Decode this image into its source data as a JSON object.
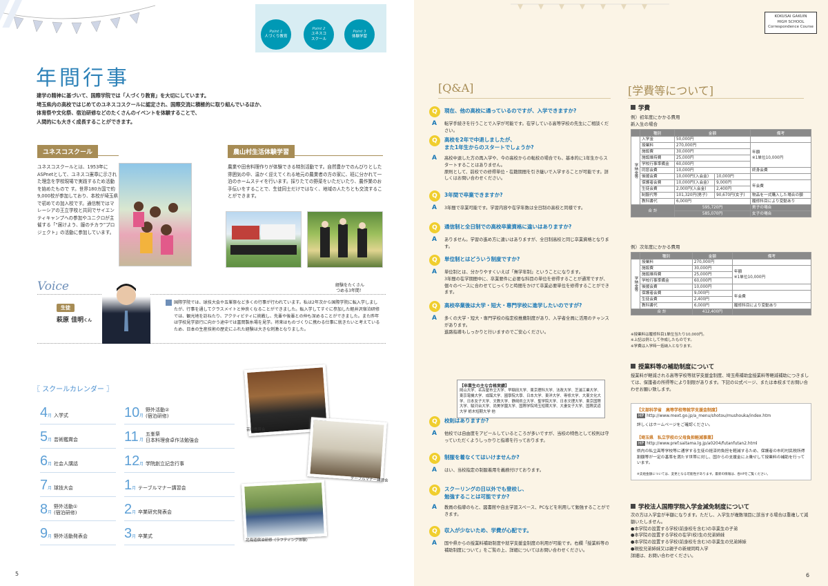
{
  "left": {
    "points": [
      {
        "tag": "Point 1",
        "label": "人づくり教育"
      },
      {
        "tag": "Point 2",
        "label": "ユネスコ\nスクール"
      },
      {
        "tag": "Point 3",
        "label": "体験学習"
      }
    ],
    "title": "年間行事",
    "intro": "建学の精神に基づいて、国際学院では「人づくり教育」を大切にしています。\n埼玉県内の高校ではじめてのユネスコスクールに認定され、国際交流に積極的に取り組んでいるほか、\n体育祭や文化祭、宿泊研修などのたくさんのイベントを体験することで、\n人間的にも大きく成長することができます。",
    "unesco": {
      "heading": "ユネスコスクール",
      "text": "ユネスコスクールとは、1953年にASPnetとして、ユネスコ憲章に示された理念を学校現場で実践するため活動を始めたもので す。世界180カ国で約9,000校が参加しており、本校が埼玉県で初めての加入校です。通信制ではマレーシアの王立学校と共同でサイエンティキャンプへの参加やユニクロが主催する「“届けよう、服のチカラ”プロジェクト」の活動に参加しています。"
    },
    "farm": {
      "heading": "農山村生活体験学習",
      "text": "農業や田舎料理作りが体験できる特別活動です。自然豊かでのんびりとした雰囲気の中、温かく迎えてくれる地元の農業者の方の家に、班に分かれて一泊のホームステイを行います。採りたての野菜をいただいたり、農作業のお手伝いをすることで、生徒同士だけではなく、地域の人たちとも交流することができます。"
    },
    "voice": {
      "label": "Voice",
      "note": "経験をたくさん\nつめる3年間！",
      "role": "生徒",
      "name": "萩原 佳明",
      "suffix": "くん",
      "text": "国際学院では、球技大会や五峯祭など多くの行事が行われています。私は2年次から国際学院に転入学しましたが、行事を通してクラスメイトと仲良くなることができました。転入学してすぐに参加した軽井沢宿泊研修では、観光地を訪ねたり、アクティビティに挑戦し、先輩や後輩との仲も深めることができました。また昨年は学校見学旅行に向かう途中では冨岡製糸場を見学。将来はものづくりに携わる仕事に就きたいと考えているため、日本の生産技術の歴史にふれた経験は大きな刺激となりました。"
    },
    "calendar": {
      "heading": "スクールカレンダー",
      "unit": "月",
      "items": [
        {
          "month": "4",
          "text": "入学式"
        },
        {
          "month": "5",
          "text": "芸術鑑賞会"
        },
        {
          "month": "6",
          "text": "社会人講話"
        },
        {
          "month": "7",
          "text": "球技大会"
        },
        {
          "month": "8",
          "text": "野外活動①\n(宿泊研修)"
        },
        {
          "month": "9",
          "text": "野外活動発表会"
        },
        {
          "month": "10",
          "text": "野外活動②\n(宿泊研修)"
        },
        {
          "month": "11",
          "text": "五峯祭\n日本料理食卓作法勉強会"
        },
        {
          "month": "12",
          "text": "学院創立記念行事"
        },
        {
          "month": "1",
          "text": "テーブルマナー講習会"
        },
        {
          "month": "2",
          "text": "卒業研究発表会"
        },
        {
          "month": "3",
          "text": "卒業式"
        }
      ]
    },
    "captions": {
      "art": "芸術鑑賞会",
      "manner": "テーブルマナー講習会",
      "rafting": "北海道宿泊研修（ラフティング体験）"
    },
    "page": "5"
  },
  "right": {
    "badge": "KOKUSAI GAKUIN\nHIGH SCHOOL\nCorrespondence Course",
    "qa_title": "[Q&A]",
    "qa": [
      {
        "q": "現在、他の高校に通っているのですが、入学できますか?",
        "a": "転学手続きを行うことで入学が可能です。在学している高等学校の先生にご相談ください。"
      },
      {
        "q": "高校を2年で中退しましたが、\nまた1年生からのスタートでしょうか?",
        "a": "高校中退した方の再入学や、今の高校からの転校の場合でも、基本的に1年生からスタートすることはありません。\n原則として、前校での修得単位・在籍期間を引き継いで入学することが可能です。詳しくはお問い合わせください。"
      },
      {
        "q": "3年間で卒業できますか?",
        "a": "3年間で卒業可能です。学習内容や在学年数は全日制の高校と同様です。"
      },
      {
        "q": "通信制と全日制での高校卒業資格に違いはありますか?",
        "a": "ありません。学習の進め方に違いはありますが、全日制高校と同じ卒業資格となります。"
      },
      {
        "q": "単位制とはどういう制度ですか?",
        "a": "単位制とは、分かりやすくいえば「無学年制」ということになります。\n3年間の在学期間中に、卒業要件に必要な科目の単位を修得することが通常ですが、個々のペースに合わせてじっくりと時間をかけて卒業必要単位を修得することができます。"
      },
      {
        "q": "高校卒業後は大学・短大・専門学校に進学したいのですが?",
        "a": "多くの大学・短大・専門学校の指定校推薦制度があり、入学者全員に活用のチャンスがあります。\n進路指導もしっかりと行いますのでご安心ください。"
      },
      {
        "q": "校則はありますか?",
        "a": "他校では自由度をアピールしているところが多いですが、当校の特色として校則は守っていただくようしっかりと指導を行っております。"
      },
      {
        "q": "制服を着なくてはいけませんか?",
        "a": "はい、当校指定の制服着用を義務付けております。"
      },
      {
        "q": "スクーリングの日以外でも登校し、\n勉強することは可能ですか?",
        "a": "教員の指導のもと、図書館や自主学習スペース、PCなどを利用して勉強することができます。"
      },
      {
        "q": "収入が少ないため、学費が心配です。",
        "a": "国や県からの授業料補助制度や就学支援金制度の利用が可能です。右欄「授業料等の補助制度について」をご覧の上、詳細についてはお問い合わせください。"
      }
    ],
    "results": {
      "title": "【卒業生の主な合格実績】",
      "text": "岡山大学、名古屋市立大学、早稲田大学、東京理科大学、法政大学、芝浦工業大学、東京電機大学、成蹊大学、國學院大學、日本大学、東洋大学、専修大学、大東文化大学、日本女子大学、文教大学、静岡県立大学、聖学院大学、日本文理大学、東京国際大学、駿河台大学、尚美学園大学、国際学院埼玉短期大学、大妻女子大学、国際武道大学 栃木短期大学 他"
    },
    "fee_title": "[学費等について]",
    "fee": {
      "heading": "学費",
      "case1": "例）初年度にかかる費用\n新入生の場合",
      "col": [
        "種別",
        "金額",
        "備考"
      ],
      "side": "学納金等",
      "rows1": [
        [
          "入学金",
          "50,000円",
          "",
          ""
        ],
        [
          "授業料",
          "270,000円",
          "",
          ""
        ],
        [
          "施設費",
          "30,000円",
          "",
          ""
        ],
        [
          "施設維持費",
          "25,000円",
          "",
          ""
        ],
        [
          "学校行事準備金",
          "60,000円",
          "",
          ""
        ],
        [
          "同窓会費",
          "10,000円",
          "",
          "終身会費"
        ],
        [
          "後援会費",
          "10,000円(入会金)",
          "10,000円",
          ""
        ],
        [
          "保護者会費",
          "10,000円(入会金)",
          "9,000円",
          "年会費"
        ],
        [
          "生徒会費",
          "2,000円(入会金)",
          "2,400円",
          ""
        ],
        [
          "制服代等",
          "101,320円(男子)",
          "90,670円(女子)",
          "物品を一式購入した場合の額"
        ],
        [
          "教科書代",
          "6,000円",
          "",
          "履修科目により変動あり"
        ]
      ],
      "note1a": "年額\n※1単位10,000円",
      "total1": "合 計",
      "totals1": [
        "595,720円",
        "585,070円"
      ],
      "totalsNote1": [
        "男子の場合",
        "女子の場合"
      ],
      "case2": "例）次年度にかかる費用",
      "rows2": [
        [
          "授業料",
          "270,000円",
          ""
        ],
        [
          "施設費",
          "30,000円",
          ""
        ],
        [
          "施設維持費",
          "25,000円",
          ""
        ],
        [
          "学校行事準備金",
          "60,000円",
          ""
        ],
        [
          "後援会費",
          "10,000円",
          ""
        ],
        [
          "保護者会費",
          "9,000円",
          "年会費"
        ],
        [
          "生徒会費",
          "2,400円",
          ""
        ],
        [
          "教科書代",
          "6,000円",
          "履修科目により変動あり"
        ]
      ],
      "note2a": "年額\n※1単位10,000円",
      "total2": "412,400円",
      "notes": "※授業料は履修科目1単位当たり10,000円。\n※上記は例として作成したものです。\n※学費は入学時一括納入となります。"
    },
    "aid": {
      "heading": "授業料等の補助制度について",
      "text": "授業料が軽減される高等学校等就学支援金制度、埼玉県補助金授業料等軽減補助につきましては、保護者の所得等により制限があります。下記の公式ページ、または本校までお問い合わせお願い致します。",
      "box1title": "【文部科学省　高等学校等就学支援金制度】",
      "url1": "http://www.mext.go.jp/a_menu/shotou/mushouka/index.htm",
      "box1note": "詳しくはホームページをご確認ください。",
      "box2title": "【埼玉県　私立学校の父母負担軽減事業】",
      "url2": "http://www.pref.saitama.lg.jp/a0204/futanfutan2.html",
      "box2text": "県内の私立高等学校等に通学する生徒の経済的負担を軽減するため、保護者の市町村民税所得割額等が一定の基準を満たす世帯に対し、国からの支援金に上乗せして授業料の補助を行っています。",
      "hp": "HP",
      "footnote": "※支給金額については、変更となる可能性があります。最新の情報は、各HPをご覧ください。"
    },
    "exempt": {
      "heading": "学校法人国際学院入学金減免制度について",
      "text": "次の方は入学金が半額になります。ただし、入学生が複数項目に該当する場合は重複して減額いたしません。\n●本学院の設置する学校(前身校を含む)の卒業生の子弟\n●本学院の設置する学校の在学(校)生の兄弟姉妹\n●本学院の設置する学校(前身校を含む)の卒業生の兄弟姉妹\n●現役兄弟姉妹又は親子の新規同時入学\n詳細は、お問い合わせください。"
    },
    "page": "6"
  }
}
